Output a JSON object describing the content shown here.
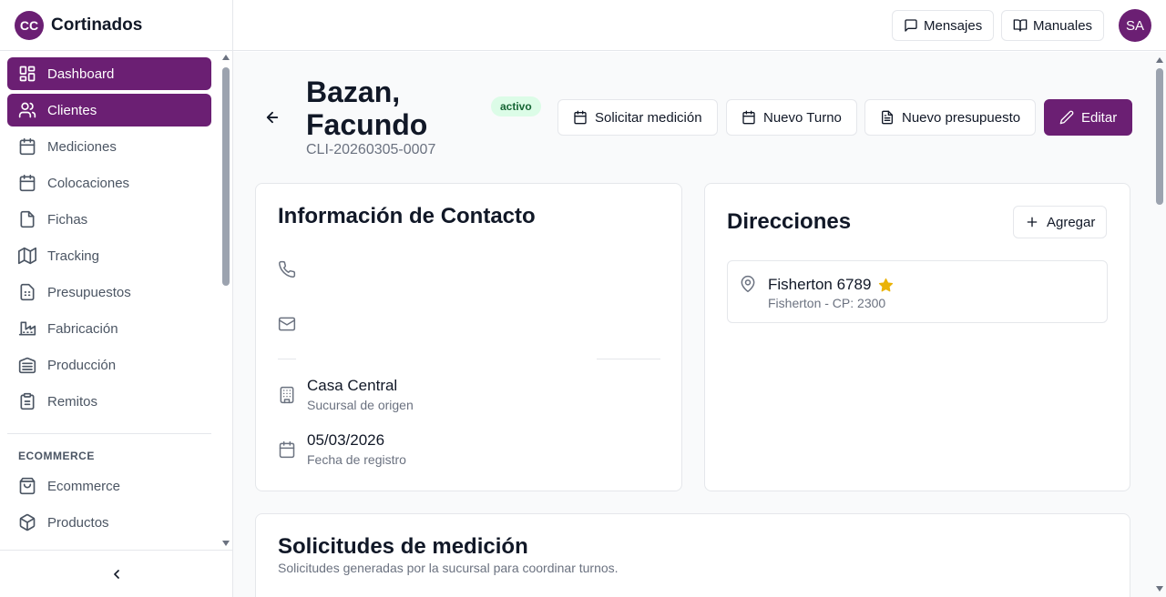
{
  "brand": {
    "initials": "CC",
    "name": "Cortinados"
  },
  "sidebar": {
    "items": [
      {
        "label": "Dashboard",
        "icon": "dashboard-icon",
        "active": true
      },
      {
        "label": "Clientes",
        "icon": "users-icon",
        "active": true
      },
      {
        "label": "Mediciones",
        "icon": "calendar-icon",
        "active": false
      },
      {
        "label": "Colocaciones",
        "icon": "calendar-icon",
        "active": false
      },
      {
        "label": "Fichas",
        "icon": "file-icon",
        "active": false
      },
      {
        "label": "Tracking",
        "icon": "map-icon",
        "active": false
      },
      {
        "label": "Presupuestos",
        "icon": "calculator-icon",
        "active": false
      },
      {
        "label": "Fabricación",
        "icon": "factory-icon",
        "active": false
      },
      {
        "label": "Producción",
        "icon": "warehouse-icon",
        "active": false
      },
      {
        "label": "Remitos",
        "icon": "clipboard-icon",
        "active": false
      }
    ],
    "section_label": "ECOMMERCE",
    "ecommerce_items": [
      {
        "label": "Ecommerce",
        "icon": "shopping-bag-icon"
      },
      {
        "label": "Productos",
        "icon": "package-icon"
      }
    ]
  },
  "topbar": {
    "messages_label": "Mensajes",
    "manuals_label": "Manuales",
    "avatar_initials": "SA"
  },
  "client": {
    "name": "Bazan, Facundo",
    "code": "CLI-20260305-0007",
    "status": "activo"
  },
  "actions": {
    "request_measurement": "Solicitar medición",
    "new_appointment": "Nuevo Turno",
    "new_quote": "Nuevo presupuesto",
    "edit": "Editar"
  },
  "contact_card": {
    "title": "Información de Contacto",
    "branch_value": "Casa Central",
    "branch_label": "Sucursal de origen",
    "date_value": "05/03/2026",
    "date_label": "Fecha de registro"
  },
  "addresses_card": {
    "title": "Direcciones",
    "add_label": "Agregar",
    "items": [
      {
        "street": "Fisherton 6789",
        "detail": "Fisherton - CP: 2300",
        "favorite": true
      }
    ]
  },
  "requests_card": {
    "title": "Solicitudes de medición",
    "subtitle": "Solicitudes generadas por la sucursal para coordinar turnos."
  },
  "colors": {
    "brand": "#6b1f73",
    "badge_bg": "#dcfce7",
    "badge_text": "#166534",
    "star": "#eab308"
  }
}
